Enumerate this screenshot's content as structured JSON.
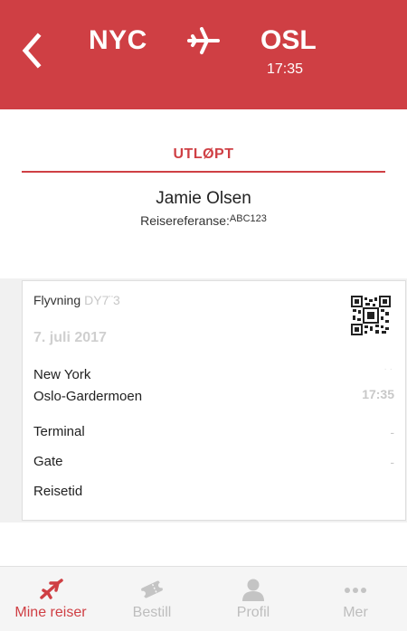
{
  "header": {
    "origin": "NYC",
    "destination": "OSL",
    "arrival_time": "17:35",
    "icons": {
      "back": "chevron-left-icon",
      "plane": "airplane-icon"
    },
    "color": "#cf3f44"
  },
  "booking": {
    "status": "UTLØPT",
    "passenger_name": "Jamie Olsen",
    "reference_label": "Reisereferanse:",
    "reference_code": "ABC123"
  },
  "flight": {
    "label": "Flyvning",
    "number": "DY7¨3",
    "date": "7. juli 2017",
    "from_city": "New York",
    "from_time": "· ·",
    "to_city": "Oslo-Gardermoen",
    "to_time": "17:35",
    "details": [
      {
        "label": "Terminal",
        "value": "-"
      },
      {
        "label": "Gate",
        "value": "-"
      },
      {
        "label": "Reisetid",
        "value": ""
      }
    ]
  },
  "tabbar": {
    "active_color": "#cf3f44",
    "inactive_color": "#bdbdbd",
    "tabs": [
      {
        "label": "Mine reiser",
        "icon": "airplane-icon",
        "active": true
      },
      {
        "label": "Bestill",
        "icon": "ticket-icon",
        "active": false
      },
      {
        "label": "Profil",
        "icon": "user-icon",
        "active": false
      },
      {
        "label": "Mer",
        "icon": "more-dots-icon",
        "active": false
      }
    ]
  }
}
